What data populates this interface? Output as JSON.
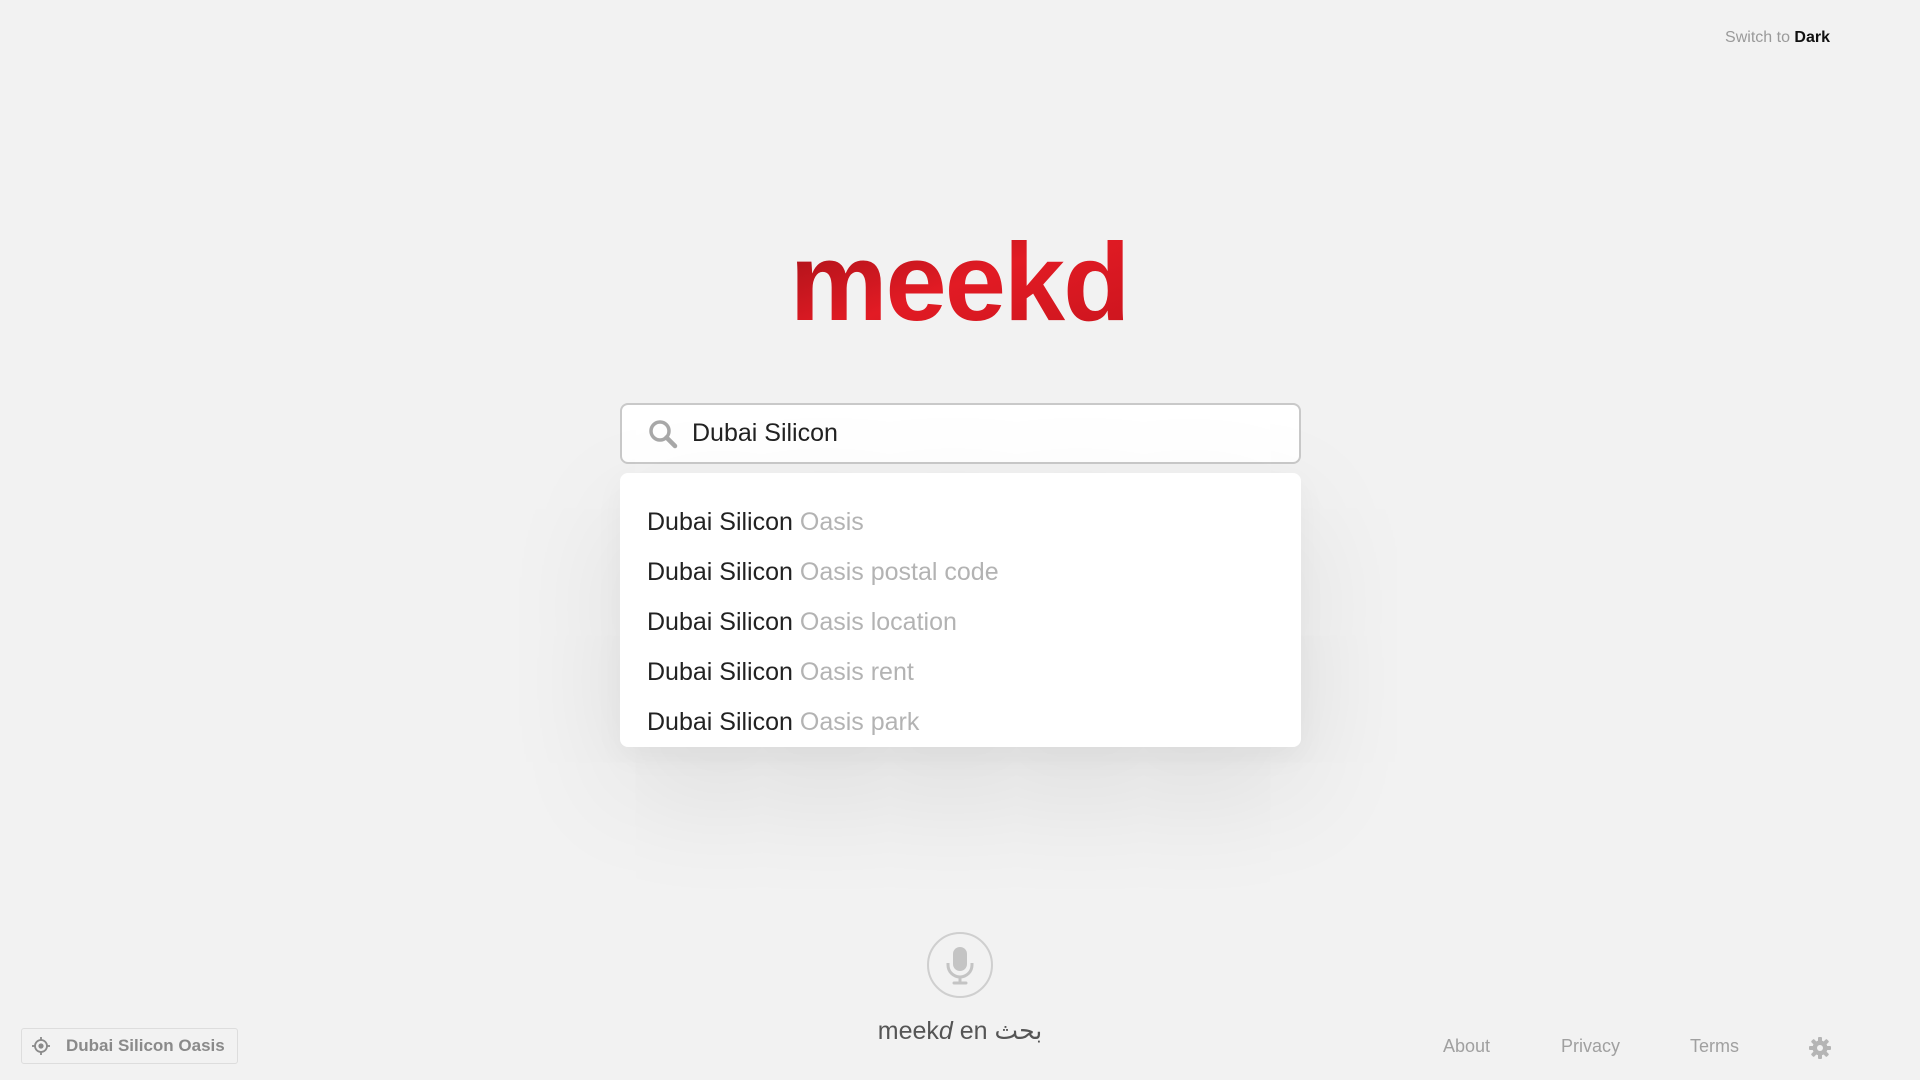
{
  "theme_switch": {
    "prefix": "Switch to",
    "target": "Dark"
  },
  "logo": {
    "text": "meekd"
  },
  "search": {
    "value": "Dubai Silicon"
  },
  "suggestions": [
    {
      "typed": "Dubai Silicon",
      "completion": "Oasis"
    },
    {
      "typed": "Dubai Silicon",
      "completion": "Oasis postal code"
    },
    {
      "typed": "Dubai Silicon",
      "completion": "Oasis location"
    },
    {
      "typed": "Dubai Silicon",
      "completion": "Oasis rent"
    },
    {
      "typed": "Dubai Silicon",
      "completion": "Oasis park"
    }
  ],
  "voice": {
    "icon": "microphone-icon"
  },
  "tagline": {
    "brand_plain": "meek",
    "brand_italic": "d",
    "middle": "en",
    "arabic": "بحث"
  },
  "location": {
    "label": "Dubai Silicon Oasis",
    "icon": "location-target-icon"
  },
  "footer": {
    "about": "About",
    "privacy": "Privacy",
    "terms": "Terms",
    "settings_icon": "gear-icon"
  },
  "colors": {
    "brand": "#d91e2a",
    "background": "#f2f2f2"
  }
}
